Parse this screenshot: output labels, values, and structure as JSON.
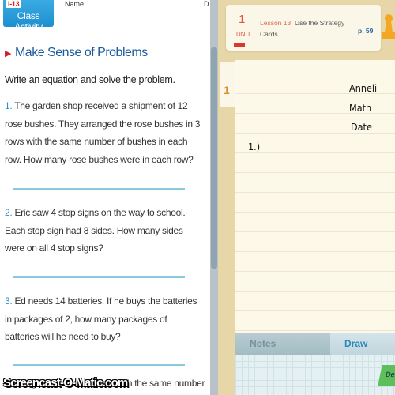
{
  "worksheet": {
    "code": "I-13",
    "badge": "Class Activity",
    "name_label": "Name",
    "date_label": "D",
    "heading": "Make Sense of Problems",
    "instructions": "Write an equation and solve the problem.",
    "problems": [
      {
        "num": "1.",
        "text": "The garden shop received a shipment of 12 rose bushes. They arranged the rose bushes in 3 rows with the same number of bushes in each row. How many rose bushes were in each row?"
      },
      {
        "num": "2.",
        "text": "Eric saw 4 stop signs on the way to school. Each stop sign had 8 sides. How many sides were on all 4 stop signs?"
      },
      {
        "num": "3.",
        "text": "Ed needs 14 batteries. If he buys the batteries in packages of 2, how many packages of batteries will he need to buy?"
      },
      {
        "num": "4.",
        "text": "A flag has 5 rows of stars with the same number"
      }
    ]
  },
  "lesson": {
    "unit_number": "1",
    "unit_label": "UNIT",
    "lesson_label": "Lesson 13:",
    "lesson_title": "Use the Strategy Cards",
    "page": "p. 59"
  },
  "notebook": {
    "tab": "1",
    "lines": [
      "Anneli",
      "Math",
      "Date",
      "1.)"
    ]
  },
  "tabs": {
    "notes": "Notes",
    "draw": "Draw"
  },
  "delete_label": "Dele",
  "watermark": "Screencast-O-Matic.com"
}
